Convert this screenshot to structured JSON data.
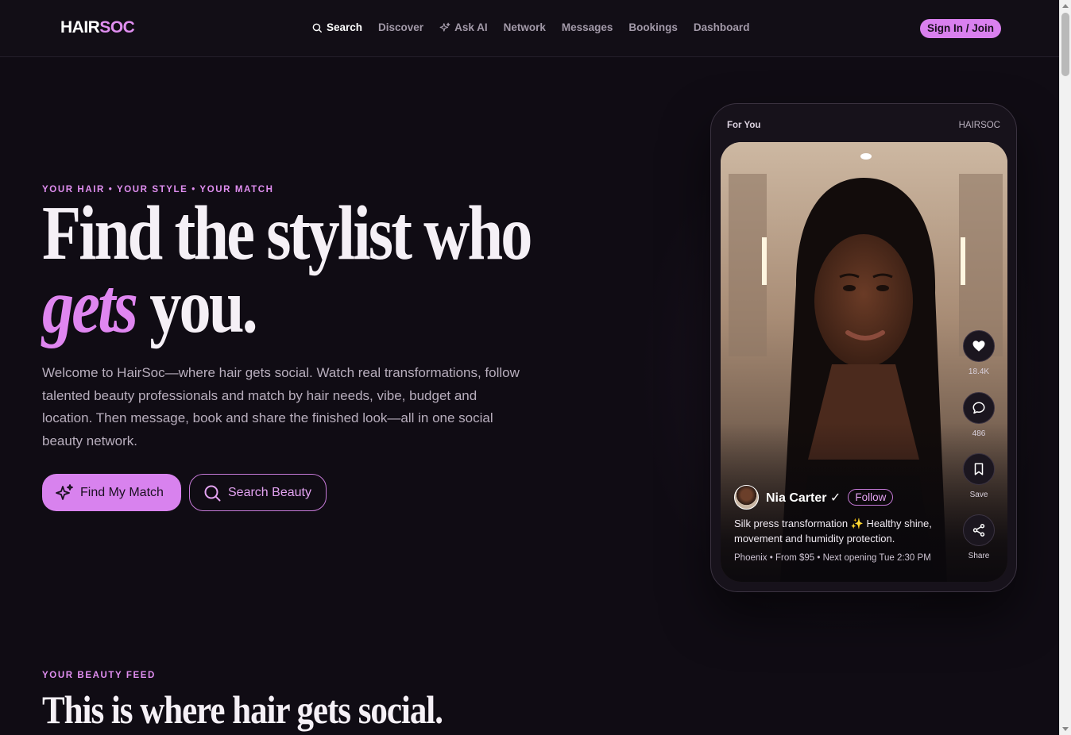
{
  "header": {
    "logo_part1": "HAIR",
    "logo_part2": "SOC",
    "nav": [
      {
        "label": "Search",
        "icon": "search-icon",
        "active": true
      },
      {
        "label": "Discover"
      },
      {
        "label": "Ask AI",
        "icon": "sparkle-icon"
      },
      {
        "label": "Network"
      },
      {
        "label": "Messages"
      },
      {
        "label": "Bookings"
      },
      {
        "label": "Dashboard"
      }
    ],
    "signin_label": "Sign In / Join"
  },
  "hero": {
    "eyebrow": "YOUR HAIR • YOUR STYLE • YOUR MATCH",
    "headline_line1": "Find the stylist who",
    "headline_accent": "gets",
    "headline_line2_rest": " you.",
    "lead": "Welcome to HairSoc—where hair gets social. Watch real transformations, follow talented beauty professionals and match by hair needs, vibe, budget and location. Then message, book and share the finished look—all in one social beauty network.",
    "primary_button": "Find My Match",
    "secondary_button": "Search Beauty"
  },
  "phone": {
    "tab_label": "For You",
    "brand": "HAIRSOC",
    "actions": [
      {
        "icon": "heart-icon",
        "label": "18.4K"
      },
      {
        "icon": "comment-icon",
        "label": "486"
      },
      {
        "icon": "bookmark-icon",
        "label": "Save"
      },
      {
        "icon": "share-icon",
        "label": "Share"
      }
    ],
    "creator_name": "Nia Carter ✓",
    "follow_label": "Follow",
    "caption": "Silk press transformation ✨ Healthy shine, movement and humidity protection.",
    "meta": "Phoenix • From $95 • Next opening Tue 2:30 PM"
  },
  "feed_section": {
    "eyebrow": "YOUR BEAUTY FEED",
    "title": "This is where hair gets social."
  },
  "colors": {
    "background": "#100c14",
    "accent": "#d980ee",
    "text": "#f4eef6"
  }
}
